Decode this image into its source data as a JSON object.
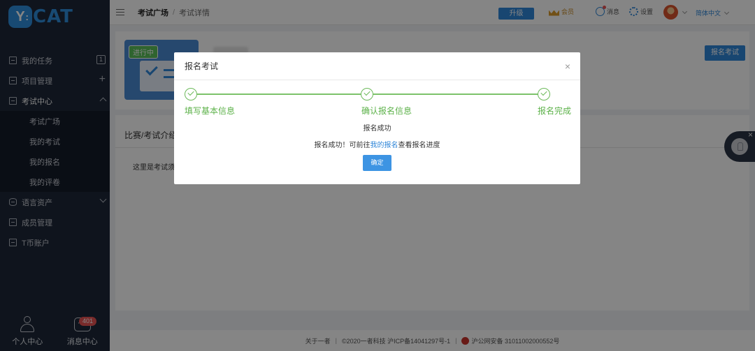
{
  "app": {
    "logo_mark": "Y",
    "logo_text": "CAT",
    "brand_color": "#2f8fdc"
  },
  "sidebar": {
    "items": [
      {
        "label": "我的任务",
        "badge": "1"
      },
      {
        "label": "项目管理"
      },
      {
        "label": "考试中心"
      },
      {
        "label": "语言资产"
      },
      {
        "label": "成员管理"
      },
      {
        "label": "T币账户"
      }
    ],
    "exam_sub": [
      "考试广场",
      "我的考试",
      "我的报名",
      "我的评卷"
    ],
    "bottom": {
      "personal": "个人中心",
      "messages": "消息中心",
      "message_count": "401"
    }
  },
  "header": {
    "breadcrumb": {
      "parent": "考试广场",
      "separator": "/",
      "current": "考试详情"
    },
    "upgrade": "升级",
    "vip": "会员",
    "messages": "消息",
    "settings": "设置",
    "language": "简体中文"
  },
  "exam": {
    "status_tag": "进行中",
    "signup_button": "报名考试",
    "intro_title": "比赛/考试介绍",
    "intro_text": "这里是考试须知"
  },
  "modal": {
    "title": "报名考试",
    "close": "×",
    "steps": [
      "填写基本信息",
      "确认报名信息",
      "报名完成"
    ],
    "success_title": "报名成功",
    "success_prefix": "报名成功！可前往",
    "success_link": "我的报名",
    "success_suffix": "查看报名进度",
    "ok_button": "确定"
  },
  "footer": {
    "about": "关于一者",
    "copyright": "©2020一者科技 沪ICP备14041297号-1",
    "police": "沪公网安备 31011002000552号"
  }
}
